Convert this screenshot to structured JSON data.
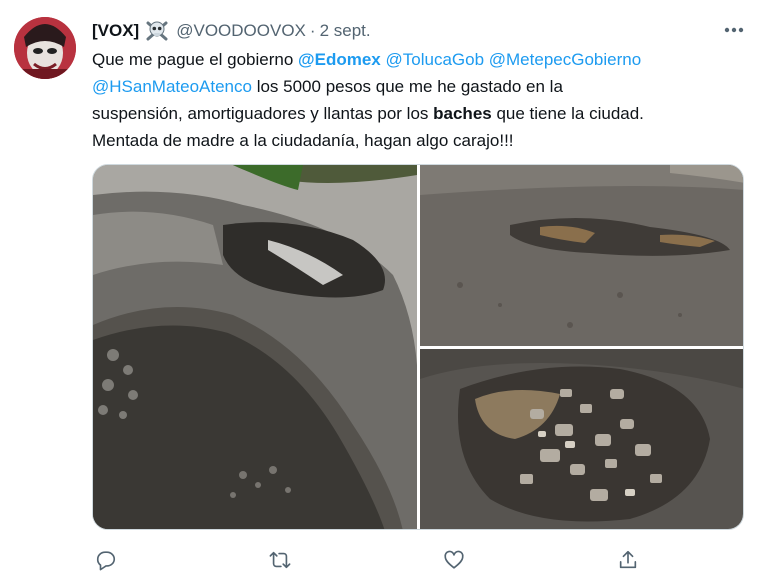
{
  "tweet": {
    "display_name": "[VOX]",
    "name_emoji_icon": "skull-crossbones-icon",
    "handle": "@VOODOOVOX",
    "separator": "·",
    "date": "2 sept.",
    "more_icon": "more-dots-icon",
    "text_segments": [
      {
        "text": "Que me pague el gobierno ",
        "kind": "plain"
      },
      {
        "text": "@Edomex",
        "kind": "mention-bold"
      },
      {
        "text": " ",
        "kind": "plain"
      },
      {
        "text": "@TolucaGob",
        "kind": "mention"
      },
      {
        "text": " ",
        "kind": "plain"
      },
      {
        "text": "@MetepecGobierno",
        "kind": "mention"
      },
      {
        "text": "@HSanMateoAtenco",
        "kind": "mention"
      },
      {
        "text": "  los 5000 pesos que me he gastado  en la",
        "kind": "plain"
      },
      {
        "text": "suspensión, amortiguadores y llantas por los ",
        "kind": "plain"
      },
      {
        "text": "baches",
        "kind": "bold"
      },
      {
        "text": " que tiene la ciudad.",
        "kind": "plain"
      },
      {
        "text": "Mentada de madre a la ciudadanía, hagan algo carajo!!!",
        "kind": "plain"
      }
    ],
    "media": [
      {
        "name": "pothole-photo-1"
      },
      {
        "name": "pothole-photo-2"
      },
      {
        "name": "pothole-photo-3"
      }
    ],
    "actions": [
      {
        "icon": "reply-icon"
      },
      {
        "icon": "retweet-icon"
      },
      {
        "icon": "like-icon"
      },
      {
        "icon": "share-icon"
      }
    ],
    "colors": {
      "accent": "#1d9bf0",
      "text": "#0f1419",
      "muted": "#536471",
      "border": "#cfd9de"
    }
  }
}
